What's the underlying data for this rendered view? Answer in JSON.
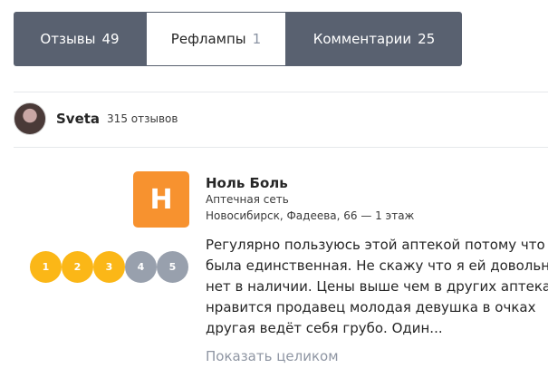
{
  "tabs": [
    {
      "label": "Отзывы",
      "count": "49"
    },
    {
      "label": "Рефлампы",
      "count": "1"
    },
    {
      "label": "Комментарии",
      "count": "25"
    }
  ],
  "user": {
    "name": "Sveta",
    "reviews": "315 отзывов"
  },
  "place": {
    "logo_letter": "H",
    "name": "Ноль Боль",
    "type": "Аптечная сеть",
    "address": "Новосибирск, Фадеева, 66 — 1 этаж"
  },
  "rating": {
    "value": 3,
    "max": 5,
    "labels": [
      "1",
      "2",
      "3",
      "4",
      "5"
    ],
    "active_color": "#fbb717",
    "inactive_color": "#98a0ad"
  },
  "review": {
    "lines": [
      "Регулярно пользуюсь этой аптекой потому что",
      "была единственная. Не скажу что я ей довольна",
      "нет в наличии. Цены выше чем в других аптеках",
      "нравится продавец молодая девушка в очках",
      "другая ведёт себя грубо. Один..."
    ],
    "show_more": "Показать целиком"
  },
  "colors": {
    "tab_bar": "#596170",
    "logo_bg": "#f7922f",
    "link_muted": "#8f96a3"
  }
}
